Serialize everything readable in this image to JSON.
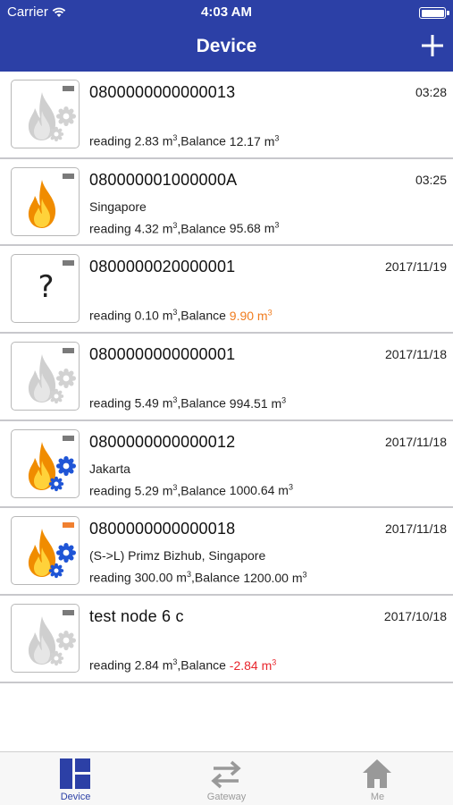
{
  "status_bar": {
    "carrier": "Carrier",
    "time": "4:03 AM"
  },
  "nav": {
    "title": "Device",
    "add_icon": "plus-icon"
  },
  "colors": {
    "brand": "#2c40a6",
    "warning": "#f07c1e",
    "negative": "#e8262d"
  },
  "devices": [
    {
      "id": "0800000000000013",
      "time": "03:28",
      "location": "",
      "reading": "reading 2.83 m",
      "balance_prefix": ",Balance ",
      "balance": "12.17 m",
      "balance_style": "normal",
      "icon": "flame-grey-gear-grey-icon",
      "battery": "grey"
    },
    {
      "id": "080000001000000A",
      "time": "03:25",
      "location": "Singapore",
      "reading": "reading 4.32 m",
      "balance_prefix": ",Balance ",
      "balance": "95.68 m",
      "balance_style": "normal",
      "icon": "flame-color-icon",
      "battery": "grey"
    },
    {
      "id": "0800000020000001",
      "time": "2017/11/19",
      "location": "",
      "reading": "reading 0.10 m",
      "balance_prefix": ",Balance ",
      "balance": "9.90 m",
      "balance_style": "orange",
      "icon": "unknown-icon",
      "battery": "grey"
    },
    {
      "id": "0800000000000001",
      "time": "2017/11/18",
      "location": "",
      "reading": "reading 5.49 m",
      "balance_prefix": ",Balance ",
      "balance": "994.51 m",
      "balance_style": "normal",
      "icon": "flame-grey-gear-grey-icon",
      "battery": "grey"
    },
    {
      "id": "0800000000000012",
      "time": "2017/11/18",
      "location": "Jakarta",
      "reading": "reading 5.29 m",
      "balance_prefix": ",Balance ",
      "balance": "1000.64 m",
      "balance_style": "normal",
      "icon": "flame-color-gear-blue-icon",
      "battery": "grey"
    },
    {
      "id": "0800000000000018",
      "time": "2017/11/18",
      "location": "(S->L) Primz Bizhub, Singapore",
      "reading": "reading 300.00 m",
      "balance_prefix": ",Balance ",
      "balance": "1200.00 m",
      "balance_style": "normal",
      "icon": "flame-color-gear-blue-icon",
      "battery": "orange"
    },
    {
      "id": "test node 6 c",
      "time": "2017/10/18",
      "location": "",
      "reading": "reading 2.84 m",
      "balance_prefix": ",Balance ",
      "balance": "-2.84 m",
      "balance_style": "red",
      "icon": "flame-grey-gear-grey-icon",
      "battery": "grey"
    }
  ],
  "unit_sup": "3",
  "unknown_glyph": "?",
  "tabs": [
    {
      "label": "Device",
      "icon": "grid-icon",
      "active": true
    },
    {
      "label": "Gateway",
      "icon": "swap-arrows-icon",
      "active": false
    },
    {
      "label": "Me",
      "icon": "home-icon",
      "active": false
    }
  ]
}
